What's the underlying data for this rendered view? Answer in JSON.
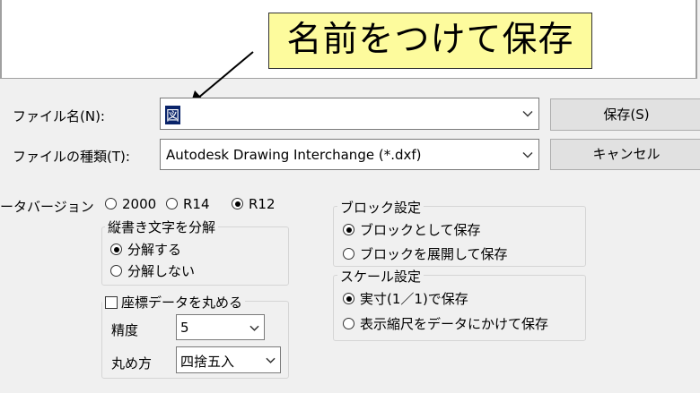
{
  "callout": {
    "text": "名前をつけて保存"
  },
  "filename": {
    "label": "ファイル名(N):",
    "value": "図"
  },
  "filetype": {
    "label": "ファイルの種類(T):",
    "value": "Autodesk Drawing Interchange (*.dxf)"
  },
  "buttons": {
    "save": "保存(S)",
    "cancel": "キャンセル"
  },
  "data_version": {
    "label": "ータバージョン",
    "options": [
      {
        "label": "2000",
        "selected": false
      },
      {
        "label": "R14",
        "selected": false
      },
      {
        "label": "R12",
        "selected": true
      }
    ]
  },
  "vertical_text": {
    "title": "縦書き文字を分解",
    "options": [
      {
        "label": "分解する",
        "selected": true
      },
      {
        "label": "分解しない",
        "selected": false
      }
    ]
  },
  "round_coords": {
    "title": "座標データを丸める",
    "checked": false,
    "precision_label": "精度",
    "precision_value": "5",
    "rounding_label": "丸め方",
    "rounding_value": "四捨五入"
  },
  "block_settings": {
    "title": "ブロック設定",
    "options": [
      {
        "label": "ブロックとして保存",
        "selected": true
      },
      {
        "label": "ブロックを展開して保存",
        "selected": false
      }
    ]
  },
  "scale_settings": {
    "title": "スケール設定",
    "options": [
      {
        "label": "実寸(1／1)で保存",
        "selected": true
      },
      {
        "label": "表示縮尺をデータにかけて保存",
        "selected": false
      }
    ]
  }
}
